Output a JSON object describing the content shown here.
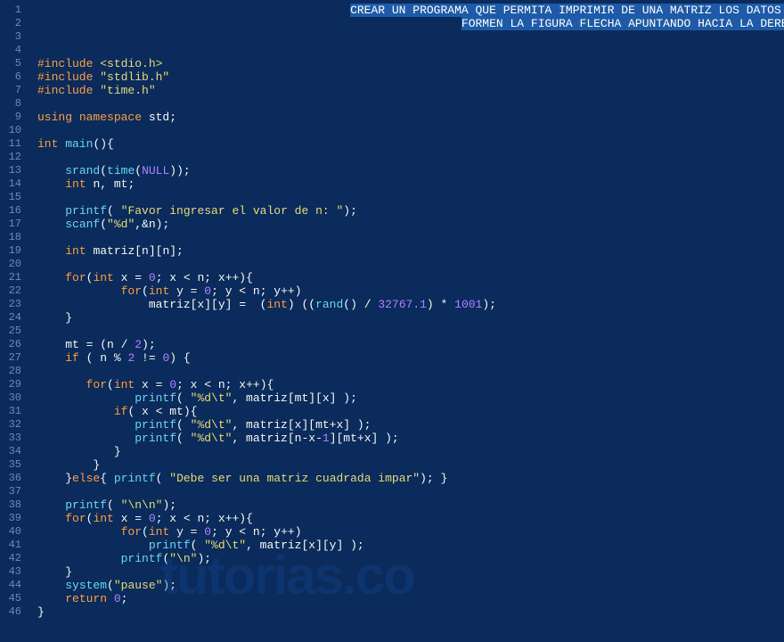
{
  "watermark": "tutorias.co",
  "lineCount": 46,
  "lines": [
    {
      "n": 1,
      "tokens": [
        {
          "t": "                                             ",
          "c": ""
        },
        {
          "t": "CREAR·UN·PROGRAMA·QUE·PERMITA·IMPRIMIR·DE·UNA·MATRIZ·LOS·DATOS·QUE",
          "c": "sel"
        }
      ]
    },
    {
      "n": 2,
      "tokens": [
        {
          "t": "                                                             ",
          "c": ""
        },
        {
          "t": "FORMEN·LA·FIGURA·FLECHA·APUNTANDO·HACIA·LA·DERECHA",
          "c": "sel"
        }
      ]
    },
    {
      "n": 3,
      "tokens": []
    },
    {
      "n": 4,
      "tokens": []
    },
    {
      "n": 5,
      "tokens": [
        {
          "t": "#include ",
          "c": "pre"
        },
        {
          "t": "<stdio.h>",
          "c": "hdr"
        }
      ]
    },
    {
      "n": 6,
      "tokens": [
        {
          "t": "#include ",
          "c": "pre"
        },
        {
          "t": "\"stdlib.h\"",
          "c": "str"
        }
      ]
    },
    {
      "n": 7,
      "tokens": [
        {
          "t": "#include ",
          "c": "pre"
        },
        {
          "t": "\"time.h\"",
          "c": "str"
        }
      ]
    },
    {
      "n": 8,
      "tokens": []
    },
    {
      "n": 9,
      "tokens": [
        {
          "t": "using ",
          "c": "kw"
        },
        {
          "t": "namespace ",
          "c": "kw"
        },
        {
          "t": "std;",
          "c": "id"
        }
      ]
    },
    {
      "n": 10,
      "tokens": []
    },
    {
      "n": 11,
      "tokens": [
        {
          "t": "int ",
          "c": "kw"
        },
        {
          "t": "main",
          "c": "fn"
        },
        {
          "t": "(){",
          "c": "id"
        }
      ]
    },
    {
      "n": 12,
      "tokens": []
    },
    {
      "n": 13,
      "tokens": [
        {
          "t": "    ",
          "c": ""
        },
        {
          "t": "srand",
          "c": "fn"
        },
        {
          "t": "(",
          "c": "id"
        },
        {
          "t": "time",
          "c": "fn"
        },
        {
          "t": "(",
          "c": "id"
        },
        {
          "t": "NULL",
          "c": "nul"
        },
        {
          "t": "));",
          "c": "id"
        }
      ]
    },
    {
      "n": 14,
      "tokens": [
        {
          "t": "    ",
          "c": ""
        },
        {
          "t": "int ",
          "c": "kw"
        },
        {
          "t": "n, mt;",
          "c": "id"
        }
      ]
    },
    {
      "n": 15,
      "tokens": []
    },
    {
      "n": 16,
      "tokens": [
        {
          "t": "    ",
          "c": ""
        },
        {
          "t": "printf",
          "c": "fn"
        },
        {
          "t": "( ",
          "c": "id"
        },
        {
          "t": "\"Favor ingresar el valor de n: \"",
          "c": "str"
        },
        {
          "t": ");",
          "c": "id"
        }
      ]
    },
    {
      "n": 17,
      "tokens": [
        {
          "t": "    ",
          "c": ""
        },
        {
          "t": "scanf",
          "c": "fn"
        },
        {
          "t": "(",
          "c": "id"
        },
        {
          "t": "\"%d\"",
          "c": "str"
        },
        {
          "t": ",&n);",
          "c": "id"
        }
      ]
    },
    {
      "n": 18,
      "tokens": []
    },
    {
      "n": 19,
      "tokens": [
        {
          "t": "    ",
          "c": ""
        },
        {
          "t": "int ",
          "c": "kw"
        },
        {
          "t": "matriz[n][n];",
          "c": "id"
        }
      ]
    },
    {
      "n": 20,
      "tokens": []
    },
    {
      "n": 21,
      "tokens": [
        {
          "t": "    ",
          "c": ""
        },
        {
          "t": "for",
          "c": "kw"
        },
        {
          "t": "(",
          "c": "id"
        },
        {
          "t": "int ",
          "c": "kw"
        },
        {
          "t": "x = ",
          "c": "id"
        },
        {
          "t": "0",
          "c": "num"
        },
        {
          "t": "; x < n; x++){",
          "c": "id"
        }
      ]
    },
    {
      "n": 22,
      "tokens": [
        {
          "t": "            ",
          "c": ""
        },
        {
          "t": "for",
          "c": "kw"
        },
        {
          "t": "(",
          "c": "id"
        },
        {
          "t": "int ",
          "c": "kw"
        },
        {
          "t": "y = ",
          "c": "id"
        },
        {
          "t": "0",
          "c": "num"
        },
        {
          "t": "; y < n; y++)",
          "c": "id"
        }
      ]
    },
    {
      "n": 23,
      "tokens": [
        {
          "t": "                matriz[x][y] =  (",
          "c": "id"
        },
        {
          "t": "int",
          "c": "kw"
        },
        {
          "t": ") ((",
          "c": "id"
        },
        {
          "t": "rand",
          "c": "fn"
        },
        {
          "t": "() / ",
          "c": "id"
        },
        {
          "t": "32767.1",
          "c": "num"
        },
        {
          "t": ") * ",
          "c": "id"
        },
        {
          "t": "1001",
          "c": "num"
        },
        {
          "t": ");",
          "c": "id"
        }
      ]
    },
    {
      "n": 24,
      "tokens": [
        {
          "t": "    }",
          "c": "id"
        }
      ]
    },
    {
      "n": 25,
      "tokens": []
    },
    {
      "n": 26,
      "tokens": [
        {
          "t": "    mt = (n / ",
          "c": "id"
        },
        {
          "t": "2",
          "c": "num"
        },
        {
          "t": ");",
          "c": "id"
        }
      ]
    },
    {
      "n": 27,
      "tokens": [
        {
          "t": "    ",
          "c": ""
        },
        {
          "t": "if",
          "c": "kw"
        },
        {
          "t": " ( n % ",
          "c": "id"
        },
        {
          "t": "2",
          "c": "num"
        },
        {
          "t": " != ",
          "c": "id"
        },
        {
          "t": "0",
          "c": "num"
        },
        {
          "t": ") {",
          "c": "id"
        }
      ]
    },
    {
      "n": 28,
      "tokens": []
    },
    {
      "n": 29,
      "tokens": [
        {
          "t": "       ",
          "c": ""
        },
        {
          "t": "for",
          "c": "kw"
        },
        {
          "t": "(",
          "c": "id"
        },
        {
          "t": "int ",
          "c": "kw"
        },
        {
          "t": "x = ",
          "c": "id"
        },
        {
          "t": "0",
          "c": "num"
        },
        {
          "t": "; x < n; x++){",
          "c": "id"
        }
      ]
    },
    {
      "n": 30,
      "tokens": [
        {
          "t": "              ",
          "c": ""
        },
        {
          "t": "printf",
          "c": "fn"
        },
        {
          "t": "( ",
          "c": "id"
        },
        {
          "t": "\"%d\\t\"",
          "c": "str"
        },
        {
          "t": ", matriz[mt][x] );",
          "c": "id"
        }
      ]
    },
    {
      "n": 31,
      "tokens": [
        {
          "t": "           ",
          "c": ""
        },
        {
          "t": "if",
          "c": "kw"
        },
        {
          "t": "( x < mt){",
          "c": "id"
        }
      ]
    },
    {
      "n": 32,
      "tokens": [
        {
          "t": "              ",
          "c": ""
        },
        {
          "t": "printf",
          "c": "fn"
        },
        {
          "t": "( ",
          "c": "id"
        },
        {
          "t": "\"%d\\t\"",
          "c": "str"
        },
        {
          "t": ", matriz[x][mt+x] );",
          "c": "id"
        }
      ]
    },
    {
      "n": 33,
      "tokens": [
        {
          "t": "              ",
          "c": ""
        },
        {
          "t": "printf",
          "c": "fn"
        },
        {
          "t": "( ",
          "c": "id"
        },
        {
          "t": "\"%d\\t\"",
          "c": "str"
        },
        {
          "t": ", matriz[n-x-",
          "c": "id"
        },
        {
          "t": "1",
          "c": "num"
        },
        {
          "t": "][mt+x] );",
          "c": "id"
        }
      ]
    },
    {
      "n": 34,
      "tokens": [
        {
          "t": "           }",
          "c": "id"
        }
      ]
    },
    {
      "n": 35,
      "tokens": [
        {
          "t": "        }",
          "c": "id"
        }
      ]
    },
    {
      "n": 36,
      "tokens": [
        {
          "t": "    }",
          "c": "id"
        },
        {
          "t": "else",
          "c": "kw"
        },
        {
          "t": "{ ",
          "c": "id"
        },
        {
          "t": "printf",
          "c": "fn"
        },
        {
          "t": "( ",
          "c": "id"
        },
        {
          "t": "\"Debe ser una matriz cuadrada impar\"",
          "c": "str"
        },
        {
          "t": "); }",
          "c": "id"
        }
      ]
    },
    {
      "n": 37,
      "tokens": []
    },
    {
      "n": 38,
      "tokens": [
        {
          "t": "    ",
          "c": ""
        },
        {
          "t": "printf",
          "c": "fn"
        },
        {
          "t": "( ",
          "c": "id"
        },
        {
          "t": "\"\\n\\n\"",
          "c": "str"
        },
        {
          "t": ");",
          "c": "id"
        }
      ]
    },
    {
      "n": 39,
      "tokens": [
        {
          "t": "    ",
          "c": ""
        },
        {
          "t": "for",
          "c": "kw"
        },
        {
          "t": "(",
          "c": "id"
        },
        {
          "t": "int ",
          "c": "kw"
        },
        {
          "t": "x = ",
          "c": "id"
        },
        {
          "t": "0",
          "c": "num"
        },
        {
          "t": "; x < n; x++){",
          "c": "id"
        }
      ]
    },
    {
      "n": 40,
      "tokens": [
        {
          "t": "            ",
          "c": ""
        },
        {
          "t": "for",
          "c": "kw"
        },
        {
          "t": "(",
          "c": "id"
        },
        {
          "t": "int ",
          "c": "kw"
        },
        {
          "t": "y = ",
          "c": "id"
        },
        {
          "t": "0",
          "c": "num"
        },
        {
          "t": "; y < n; y++)",
          "c": "id"
        }
      ]
    },
    {
      "n": 41,
      "tokens": [
        {
          "t": "                ",
          "c": ""
        },
        {
          "t": "printf",
          "c": "fn"
        },
        {
          "t": "( ",
          "c": "id"
        },
        {
          "t": "\"%d\\t\"",
          "c": "str"
        },
        {
          "t": ", matriz[x][y] );",
          "c": "id"
        }
      ]
    },
    {
      "n": 42,
      "tokens": [
        {
          "t": "            ",
          "c": ""
        },
        {
          "t": "printf",
          "c": "fn"
        },
        {
          "t": "(",
          "c": "id"
        },
        {
          "t": "\"\\n\"",
          "c": "str"
        },
        {
          "t": ");",
          "c": "id"
        }
      ]
    },
    {
      "n": 43,
      "tokens": [
        {
          "t": "    }",
          "c": "id"
        }
      ]
    },
    {
      "n": 44,
      "tokens": [
        {
          "t": "    ",
          "c": ""
        },
        {
          "t": "system",
          "c": "fn"
        },
        {
          "t": "(",
          "c": "id"
        },
        {
          "t": "\"pause\"",
          "c": "str"
        },
        {
          "t": ");",
          "c": "id"
        }
      ]
    },
    {
      "n": 45,
      "tokens": [
        {
          "t": "    ",
          "c": ""
        },
        {
          "t": "return ",
          "c": "kw"
        },
        {
          "t": "0",
          "c": "num"
        },
        {
          "t": ";",
          "c": "id"
        }
      ]
    },
    {
      "n": 46,
      "tokens": [
        {
          "t": "}",
          "c": "id"
        }
      ]
    }
  ]
}
